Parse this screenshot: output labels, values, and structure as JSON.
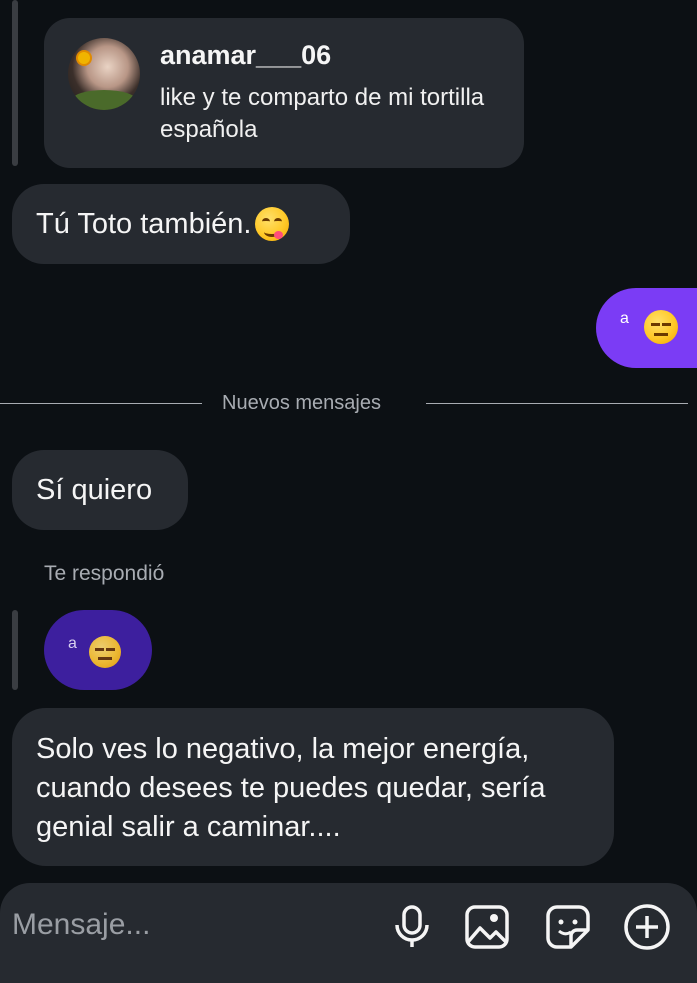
{
  "shared_post": {
    "username": "anamar___06",
    "caption": "like y te comparto de mi tortilla española"
  },
  "messages": {
    "m1": "Tú Toto también.",
    "m2_sent_text": "a",
    "m3": "Sí quiero",
    "m4_quoted_text": "a",
    "m5": "Solo ves lo negativo, la mejor energía, cuando desees te puedes quedar, sería genial salir a caminar...."
  },
  "separator": {
    "label": "Nuevos mensajes"
  },
  "reply_label": "Te respondió",
  "composer": {
    "placeholder": "Mensaje...",
    "icons": [
      "microphone-icon",
      "image-icon",
      "sticker-icon",
      "plus-circle-icon"
    ]
  },
  "colors": {
    "background": "#0c1014",
    "bubble_received": "#262a30",
    "bubble_sent": "#7b3cf5",
    "bubble_quoted_sent": "#3d1f9e"
  }
}
